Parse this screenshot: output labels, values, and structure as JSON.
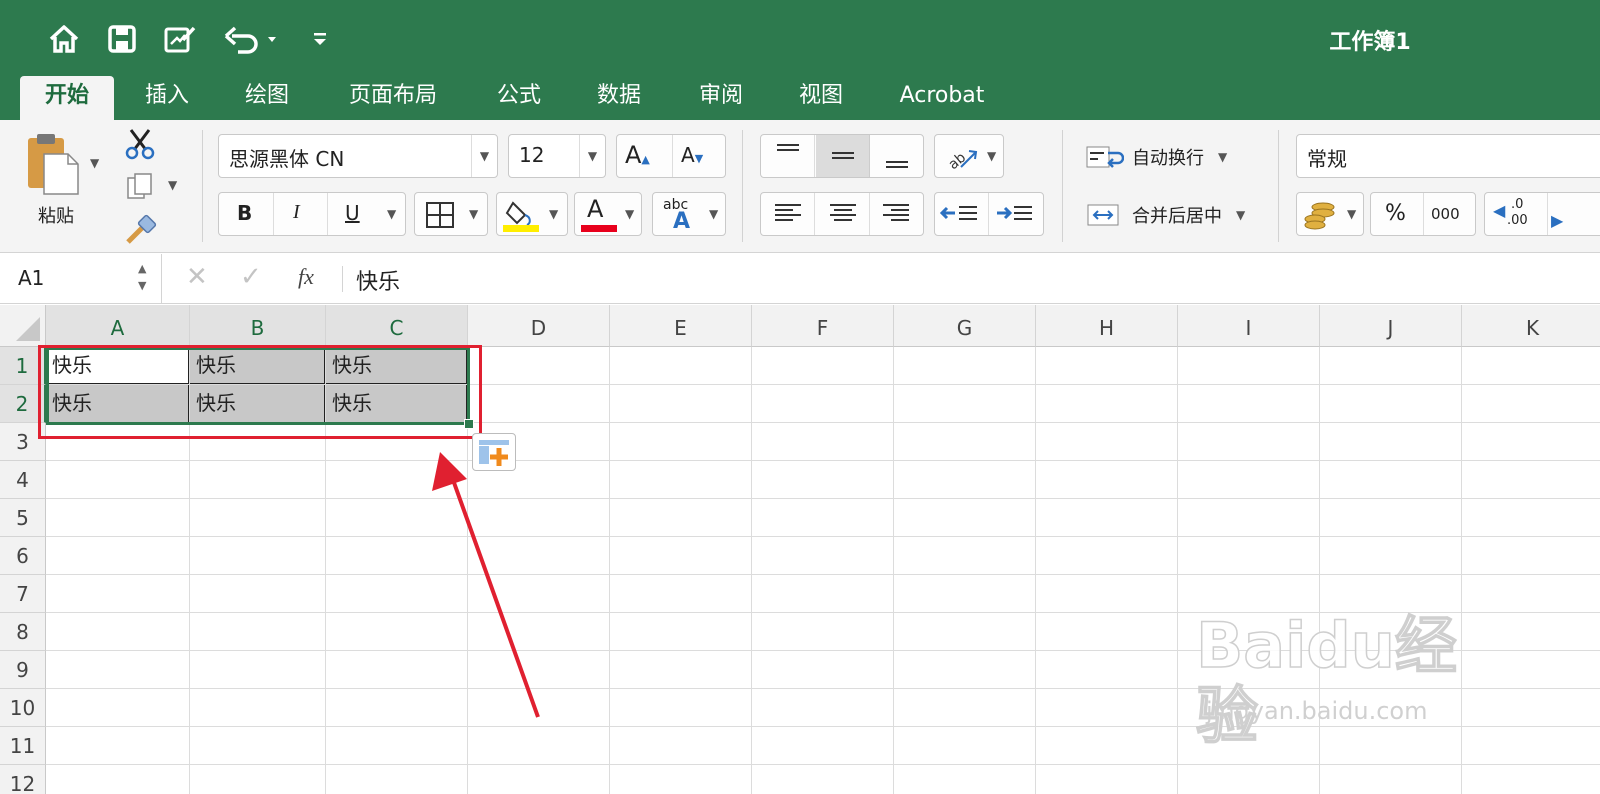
{
  "app": {
    "workbook_title": "工作簿1"
  },
  "tabs": [
    "开始",
    "插入",
    "绘图",
    "页面布局",
    "公式",
    "数据",
    "审阅",
    "视图",
    "Acrobat"
  ],
  "ribbon": {
    "paste_label": "粘贴",
    "font_name": "思源黑体 CN",
    "font_size": "12",
    "wrap_text_label": "自动换行",
    "merge_center_label": "合并后居中",
    "number_format": "常规",
    "percent_label": "%",
    "thousands_label": "000",
    "bold_label": "B",
    "italic_label": "I",
    "underline_label": "U",
    "font_color_label": "A",
    "grow_font_label": "A",
    "shrink_font_label": "A",
    "abc_label": "abc",
    "dec_label_top": ".0",
    "dec_label_bottom": ".00",
    "fill_color": "#ffee00",
    "font_color": "#e8001c"
  },
  "formula_bar": {
    "name_box": "A1",
    "fx_label": "fx",
    "formula": "快乐"
  },
  "sheet": {
    "columns": [
      "A",
      "B",
      "C",
      "D",
      "E",
      "F",
      "G",
      "H",
      "I",
      "J",
      "K"
    ],
    "rows": [
      "1",
      "2",
      "3",
      "4",
      "5",
      "6",
      "7",
      "8",
      "9",
      "10",
      "11",
      "12"
    ],
    "cells": [
      [
        "快乐",
        "快乐",
        "快乐"
      ],
      [
        "快乐",
        "快乐",
        "快乐"
      ]
    ]
  },
  "watermark": {
    "brand": "Baidu经验",
    "url": "jingyan.baidu.com"
  },
  "colors": {
    "excel_green": "#2d7a4e",
    "annotation_red": "#e02030",
    "selection_fill": "#c8c8c8"
  }
}
